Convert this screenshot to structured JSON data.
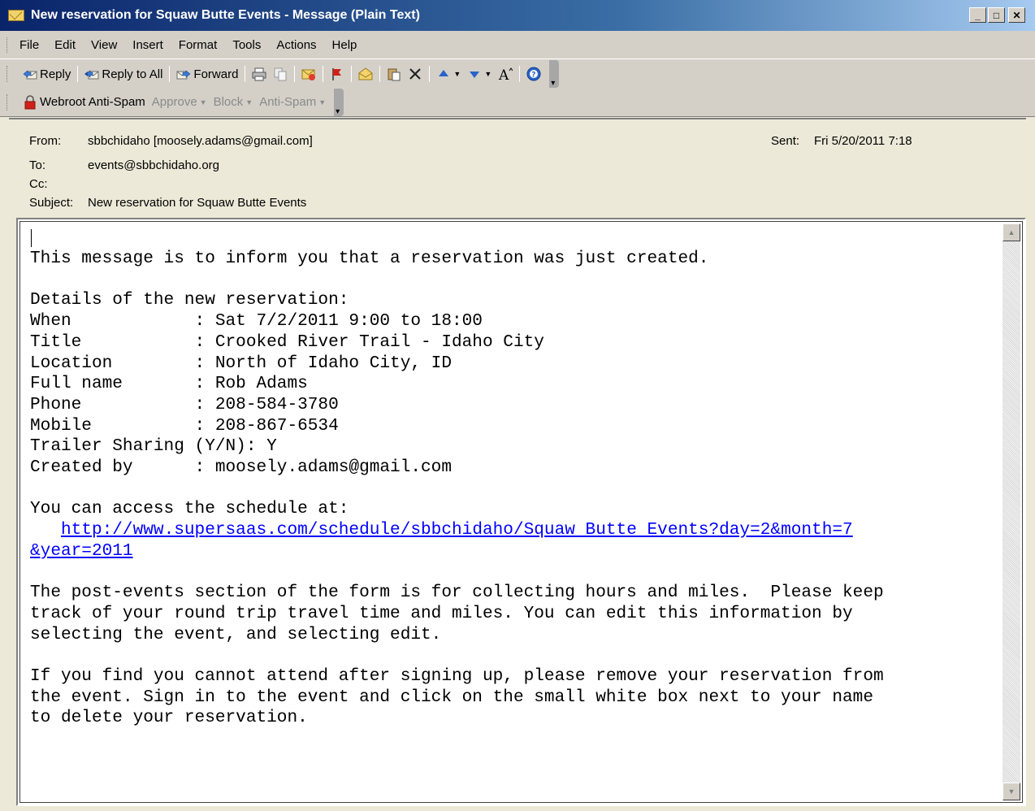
{
  "window": {
    "title": "New reservation for Squaw Butte Events - Message (Plain Text)",
    "minimize": "_",
    "maximize": "□",
    "close": "✕"
  },
  "menu": [
    "File",
    "Edit",
    "View",
    "Insert",
    "Format",
    "Tools",
    "Actions",
    "Help"
  ],
  "toolbar": {
    "reply": "Reply",
    "reply_all": "Reply to All",
    "forward": "Forward"
  },
  "antispam": {
    "brand": "Webroot Anti-Spam",
    "approve": "Approve",
    "block": "Block",
    "antispam": "Anti-Spam"
  },
  "header": {
    "from_label": "From:",
    "from_value": "sbbchidaho [moosely.adams@gmail.com]",
    "sent_label": "Sent:",
    "sent_value": "Fri 5/20/2011 7:18",
    "to_label": "To:",
    "to_value": "events@sbbchidaho.org",
    "cc_label": "Cc:",
    "cc_value": "",
    "subject_label": "Subject:",
    "subject_value": "New reservation for Squaw Butte Events"
  },
  "message": {
    "intro": "This message is to inform you that a reservation was just created.",
    "details_heading": "Details of the new reservation:",
    "when": "When            : Sat 7/2/2011 9:00 to 18:00",
    "title": "Title           : Crooked River Trail - Idaho City",
    "location": "Location        : North of Idaho City, ID",
    "full_name": "Full name       : Rob Adams",
    "phone": "Phone           : 208-584-3780",
    "mobile": "Mobile          : 208-867-6534",
    "trailer": "Trailer Sharing (Y/N): Y",
    "created_by": "Created by      : moosely.adams@gmail.com",
    "access_heading": "You can access the schedule at:",
    "link_line1": "http://www.supersaas.com/schedule/sbbchidaho/Squaw Butte Events?day=2&month=7",
    "link_line2": "&year=2011",
    "post_events": "The post-events section of the form is for collecting hours and miles.  Please keep\ntrack of your round trip travel time and miles. You can edit this information by\nselecting the event, and selecting edit.",
    "cancel_note": "If you find you cannot attend after signing up, please remove your reservation from\nthe event. Sign in to the event and click on the small white box next to your name\nto delete your reservation."
  }
}
